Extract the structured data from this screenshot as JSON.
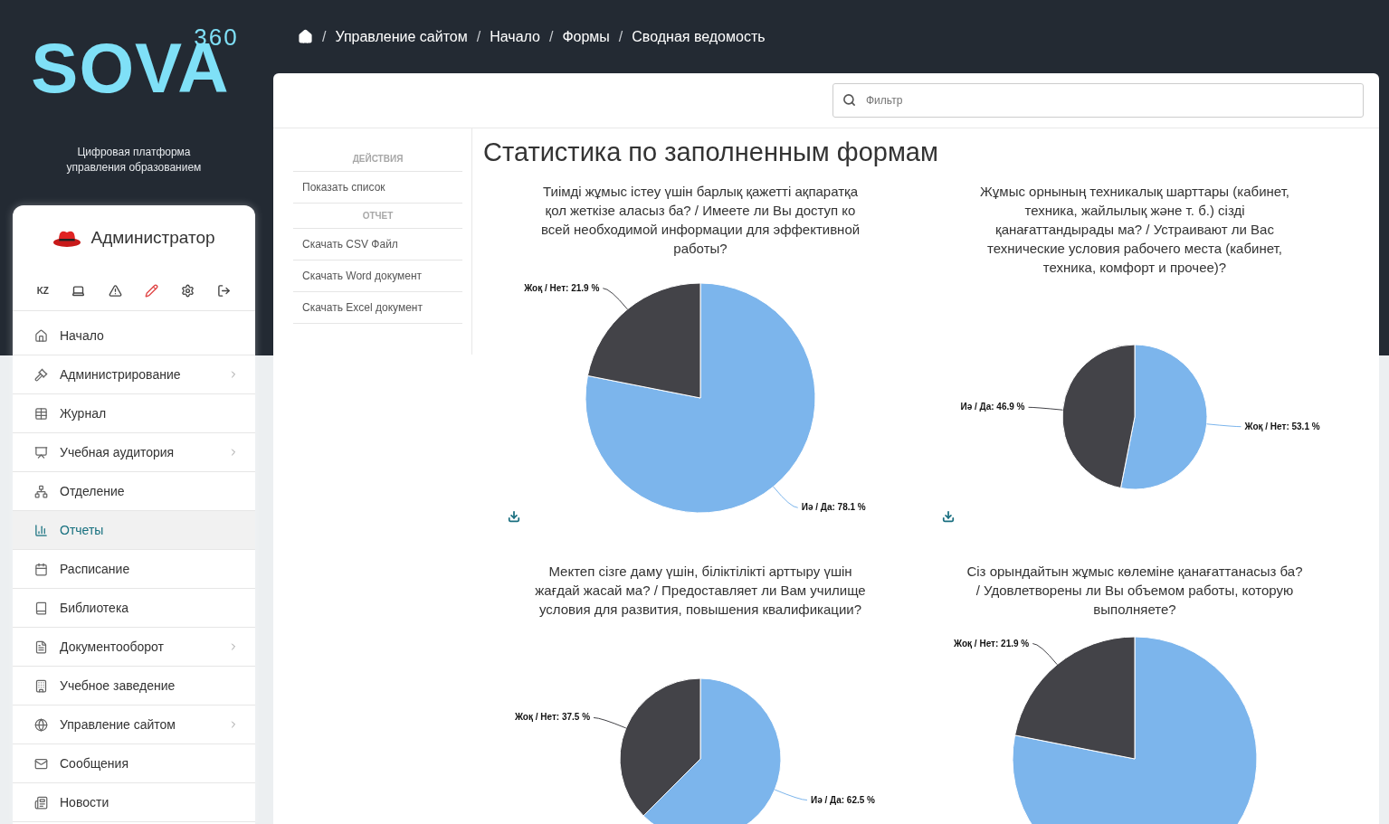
{
  "logo": {
    "text": "SOVA",
    "superscript": "360"
  },
  "tagline": "Цифровая платформа управления образованием",
  "user": {
    "name": "Администратор"
  },
  "user_toolbar": {
    "language": "KZ"
  },
  "nav": [
    {
      "label": "Начало",
      "has_submenu": false,
      "selected": false
    },
    {
      "label": "Администрирование",
      "has_submenu": true,
      "selected": false
    },
    {
      "label": "Журнал",
      "has_submenu": false,
      "selected": false
    },
    {
      "label": "Учебная аудитория",
      "has_submenu": true,
      "selected": false
    },
    {
      "label": "Отделение",
      "has_submenu": false,
      "selected": false
    },
    {
      "label": "Отчеты",
      "has_submenu": false,
      "selected": true
    },
    {
      "label": "Расписание",
      "has_submenu": false,
      "selected": false
    },
    {
      "label": "Библиотека",
      "has_submenu": false,
      "selected": false
    },
    {
      "label": "Документооборот",
      "has_submenu": true,
      "selected": false
    },
    {
      "label": "Учебное заведение",
      "has_submenu": false,
      "selected": false
    },
    {
      "label": "Управление сайтом",
      "has_submenu": true,
      "selected": false
    },
    {
      "label": "Сообщения",
      "has_submenu": false,
      "selected": false
    },
    {
      "label": "Новости",
      "has_submenu": false,
      "selected": false
    }
  ],
  "breadcrumb": {
    "separator": "/",
    "items": [
      "Управление сайтом",
      "Начало",
      "Формы",
      "Сводная ведомость"
    ]
  },
  "filter": {
    "placeholder": "Фильтр"
  },
  "actions": [
    {
      "heading": "ДЕЙСТВИЯ",
      "items": [
        "Показать список"
      ]
    },
    {
      "heading": "ОТЧЕТ",
      "items": [
        "Скачать CSV Файл",
        "Скачать Word документ",
        "Скачать Excel документ"
      ]
    }
  ],
  "page_title": "Статистика по заполненным формам",
  "charts": [
    {
      "chart_data": {
        "type": "pie",
        "title": "Тиімді жұмыс істеу үшін барлық қажетті ақпаратқа қол жеткізе аласыз ба? / Имеете ли Вы доступ ко всей необходимой информации для эффективной работы?",
        "categories": [
          "Иә / Да",
          "Жоқ / Нет"
        ],
        "values": [
          78.1,
          21.9
        ],
        "value_labels": [
          ": 78.1 %",
          ": 21.9 %"
        ]
      }
    },
    {
      "chart_data": {
        "type": "pie",
        "title": "Жұмыс орнының техникалық шарттары (кабинет, техника, жайлылық және т. б.) сізді қанағаттандырады ма? / Устраивают ли Вас технические условия рабочего места (кабинет, техника, комфорт и прочее)?",
        "categories": [
          "Жоқ / Нет",
          "Иә / Да"
        ],
        "values": [
          53.1,
          46.9
        ],
        "value_labels": [
          ": 53.1 %",
          ": 46.9 %"
        ]
      }
    },
    {
      "chart_data": {
        "type": "pie",
        "title": "Мектеп сізге даму үшін, біліктілікті арттыру үшін жағдай жасай ма? / Предоставляет ли Вам училище условия для развития, повышения квалификации?",
        "categories": [
          "Иә / Да",
          "Жоқ / Нет"
        ],
        "values": [
          62.5,
          37.5
        ],
        "value_labels": [
          ": 62.5 %",
          ": 37.5 %"
        ]
      }
    },
    {
      "chart_data": {
        "type": "pie",
        "title": "Сіз орындайтын жұмыс көлеміне қанағаттанасыз ба? / Удовлетворены ли Вы объемом работы, которую выполняете?",
        "categories": [
          null,
          "Жоқ / Нет"
        ],
        "values": [
          78.1,
          21.9
        ],
        "value_labels": [
          null,
          ": 21.9 %"
        ]
      }
    }
  ]
}
